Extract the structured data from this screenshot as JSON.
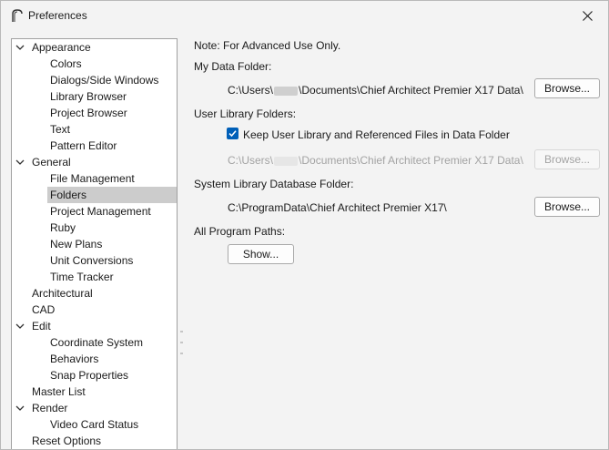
{
  "window": {
    "title": "Preferences",
    "icons": {
      "app": "chief-architect-arch-icon",
      "close": "close-icon"
    }
  },
  "tree": {
    "items": [
      {
        "label": "Appearance",
        "level": 0,
        "expanded": true
      },
      {
        "label": "Colors",
        "level": 1
      },
      {
        "label": "Dialogs/Side Windows",
        "level": 1
      },
      {
        "label": "Library Browser",
        "level": 1
      },
      {
        "label": "Project Browser",
        "level": 1
      },
      {
        "label": "Text",
        "level": 1
      },
      {
        "label": "Pattern Editor",
        "level": 1
      },
      {
        "label": "General",
        "level": 0,
        "expanded": true
      },
      {
        "label": "File Management",
        "level": 1
      },
      {
        "label": "Folders",
        "level": 1,
        "selected": true
      },
      {
        "label": "Project Management",
        "level": 1
      },
      {
        "label": "Ruby",
        "level": 1
      },
      {
        "label": "New Plans",
        "level": 1
      },
      {
        "label": "Unit Conversions",
        "level": 1
      },
      {
        "label": "Time Tracker",
        "level": 1
      },
      {
        "label": "Architectural",
        "level": 0
      },
      {
        "label": "CAD",
        "level": 0
      },
      {
        "label": "Edit",
        "level": 0,
        "expanded": true
      },
      {
        "label": "Coordinate System",
        "level": 1
      },
      {
        "label": "Behaviors",
        "level": 1
      },
      {
        "label": "Snap Properties",
        "level": 1
      },
      {
        "label": "Master List",
        "level": 0
      },
      {
        "label": "Render",
        "level": 0,
        "expanded": true
      },
      {
        "label": "Video Card Status",
        "level": 1
      },
      {
        "label": "Reset Options",
        "level": 0
      }
    ]
  },
  "panel": {
    "note": "Note: For Advanced Use Only.",
    "my_data_folder": {
      "heading": "My Data Folder:",
      "path_prefix": "C:\\Users\\",
      "path_suffix": "\\Documents\\Chief Architect Premier X17 Data\\",
      "browse_label": "Browse..."
    },
    "user_library": {
      "heading": "User Library Folders:",
      "checkbox_label": "Keep User Library and Referenced Files in Data Folder",
      "checked": true,
      "path_prefix": "C:\\Users\\",
      "path_suffix": "\\Documents\\Chief Architect Premier X17 Data\\",
      "browse_label": "Browse...",
      "disabled": true
    },
    "system_library": {
      "heading": "System Library Database Folder:",
      "path": "C:\\ProgramData\\Chief Architect Premier X17\\",
      "browse_label": "Browse..."
    },
    "all_paths": {
      "heading": "All Program Paths:",
      "show_label": "Show..."
    }
  },
  "colors": {
    "accent": "#005fb8",
    "selection": "#cccccc",
    "disabled_text": "#a3a3a3"
  }
}
